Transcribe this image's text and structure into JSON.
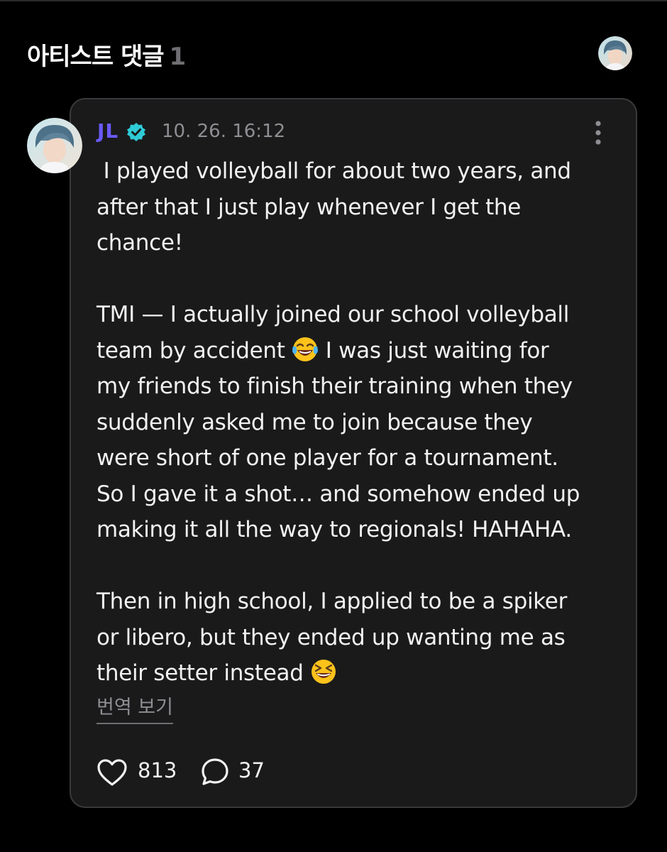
{
  "header": {
    "title": "아티스트 댓글",
    "count": "1",
    "avatar_icon": "user-avatar-icon"
  },
  "comment": {
    "author": "JL",
    "verified_icon": "verified-badge-icon",
    "timestamp": "10. 26. 16:12",
    "more_icon": "more-vertical-icon",
    "paragraphs": [
      " I played volleyball for about two years, and\nafter that I just play whenever I get the\nchance!",
      "TMI — I actually joined our school volleyball\nteam by accident ",
      " I was just waiting for\nmy friends to finish their training when they\nsuddenly asked me to join because they\nwere short of one player for a tournament.\nSo I gave it a shot… and somehow ended up\nmaking it all the way to regionals! HAHAHA.",
      "Then in high school, I applied to be a spiker\nor libero, but they ended up wanting me as\ntheir setter instead "
    ],
    "emoji_1": "tears-of-joy-emoji",
    "emoji_2": "grinning-squinting-emoji",
    "translate_label": "번역 보기",
    "likes": "813",
    "replies": "37"
  },
  "colors": {
    "background": "#000000",
    "card": "#1a1a1b",
    "card_border": "#3a3a3d",
    "author_name": "#6a5af9",
    "verified": "#2ecbd6",
    "muted_text": "#8e8e93"
  }
}
